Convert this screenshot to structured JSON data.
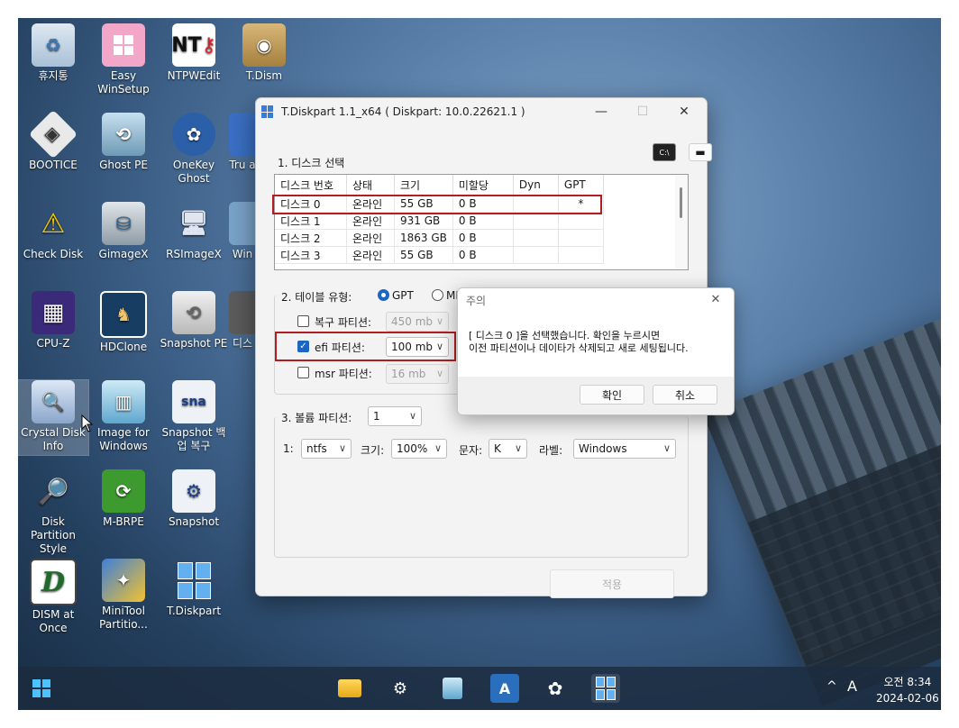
{
  "desktop": {
    "icons": [
      {
        "label": "휴지통"
      },
      {
        "label": "Easy WinSetup"
      },
      {
        "label": "NTPWEdit"
      },
      {
        "label": "T.Dism"
      },
      {
        "label": "BOOTICE"
      },
      {
        "label": "Ghost PE"
      },
      {
        "label": "OneKey Ghost"
      },
      {
        "label": "Tru a"
      },
      {
        "label": "Check Disk"
      },
      {
        "label": "GimageX"
      },
      {
        "label": "RSImageX"
      },
      {
        "label": "Win"
      },
      {
        "label": "CPU-Z"
      },
      {
        "label": "HDClone"
      },
      {
        "label": "Snapshot PE"
      },
      {
        "label": "디스"
      },
      {
        "label": "Crystal Disk Info"
      },
      {
        "label": "Image for Windows"
      },
      {
        "label": "Snapshot 백업 복구"
      },
      {
        "label": "Disk Partition Style"
      },
      {
        "label": "M-BRPE"
      },
      {
        "label": "Snapshot"
      },
      {
        "label": "DISM at Once"
      },
      {
        "label": "MiniTool Partitio..."
      },
      {
        "label": "T.Diskpart"
      }
    ],
    "icon_glyphs": {
      "ntp": "NT",
      "sna": "sna",
      "dism": "D",
      "cpu": "▦"
    }
  },
  "window": {
    "title": "T.Diskpart 1.1_x64 ( Diskpart: 10.0.22621.1 )",
    "controls": {
      "minimize": "—",
      "maximize": "☐",
      "close": "✕"
    },
    "tool_buttons": {
      "cmd": "C:\\",
      "drive": "▬"
    },
    "section1": "1. 디스크 선택",
    "table": {
      "headers": [
        "디스크 번호",
        "상태",
        "크기",
        "미할당",
        "Dyn",
        "GPT"
      ],
      "rows": [
        [
          "디스크 0",
          "온라인",
          "55 GB",
          "0 B",
          "",
          "*"
        ],
        [
          "디스크 1",
          "온라인",
          "931 GB",
          "0 B",
          "",
          ""
        ],
        [
          "디스크 2",
          "온라인",
          "1863 GB",
          "0 B",
          "",
          ""
        ],
        [
          "디스크 3",
          "온라인",
          "55 GB",
          "0 B",
          "",
          ""
        ]
      ]
    },
    "section2": "2. 테이블 유형:",
    "gpt": "GPT",
    "mbr": "MBR",
    "recovery_label": "복구 파티션:",
    "recovery_value": "450 mb",
    "efi_label": "efi 파티션:",
    "efi_value": "100 mb",
    "msr_label": "msr 파티션:",
    "msr_value": "16 mb",
    "section3": "3. 볼륨 파티션:",
    "volume_count": "1",
    "vol_index": "1:",
    "fs_value": "ntfs",
    "size_label": "크기:",
    "size_value": "100%",
    "letter_label": "문자:",
    "letter_value": "K",
    "name_label": "라벨:",
    "name_value": "Windows",
    "apply": "적용",
    "check_mark": "✓",
    "dropdown_arrow": "∨"
  },
  "dialog": {
    "title": "주의",
    "close": "✕",
    "message": "[ 디스크 0 ]을 선택했습니다. 확인을 누르시면\n이전 파티션이나 데이타가 삭제되고 새로 세팅됩니다.",
    "ok": "확인",
    "cancel": "취소"
  },
  "taskbar": {
    "start_icon": "windows-start-icon",
    "apps": [
      "file-explorer-icon",
      "snapshot-icon",
      "image-for-windows-icon",
      "acronis-icon",
      "onekey-ghost-icon",
      "tdiskpart-icon"
    ],
    "tray_chevron": "^",
    "ime": "A",
    "time": "오전 8:34",
    "date": "2024-02-06"
  }
}
